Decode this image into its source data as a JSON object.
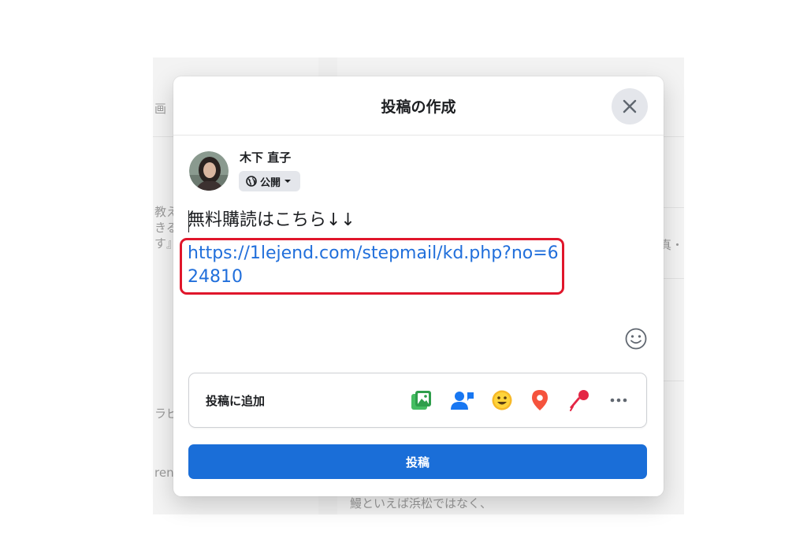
{
  "background": {
    "snippets": [
      "画",
      "教え",
      "きる",
      "す』",
      "ラピ",
      "ren",
      "真・",
      "鰻といえば浜松ではなく、"
    ]
  },
  "modal": {
    "title": "投稿の作成",
    "user": {
      "name": "木下 直子",
      "audience": "公開"
    },
    "post": {
      "text": "無料購読はこちら↓↓",
      "link": "https://1lejend.com/stepmail/kd.php?no=624810"
    },
    "add_to_post": {
      "label": "投稿に追加",
      "icons": [
        "photo-video-icon",
        "tag-people-icon",
        "feeling-icon",
        "check-in-icon",
        "live-event-icon",
        "more-icon"
      ]
    },
    "submit_label": "投稿"
  },
  "colors": {
    "accent": "#1a6ed8",
    "link": "#216fdb",
    "highlight": "#e0162b",
    "photo_green": "#45bd62",
    "tag_blue": "#1877f2",
    "feeling_yellow": "#f7b928",
    "checkin_red": "#f5533d"
  }
}
